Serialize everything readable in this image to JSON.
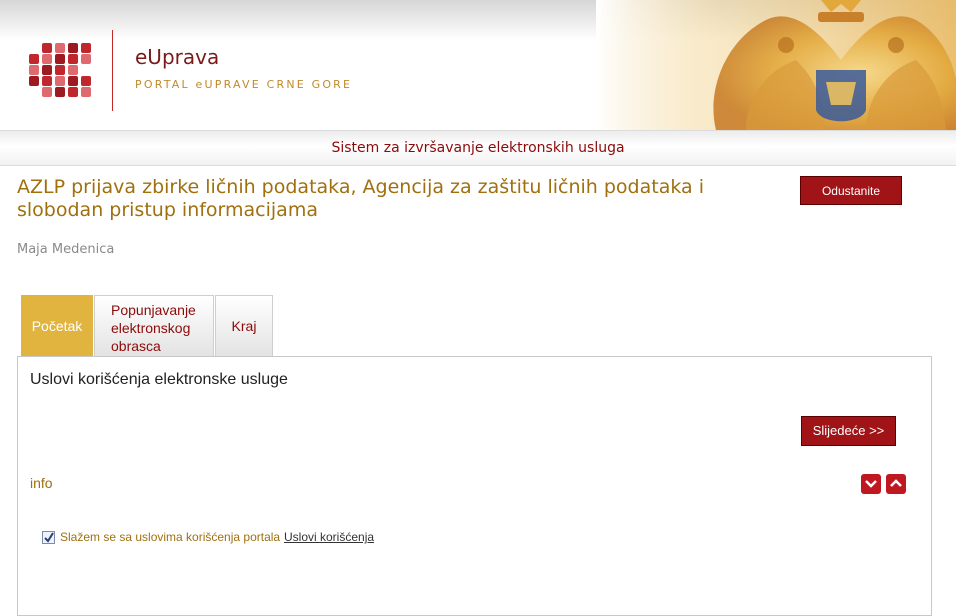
{
  "header": {
    "brand_title": "eUprava",
    "brand_subtitle": "PORTAL eUPRAVE CRNE GORE",
    "logo_icon": "eUprava-logo-icon",
    "emblem_icon": "montenegro-coat-of-arms-icon"
  },
  "service_bar": {
    "text": "Sistem za izvršavanje elektronskih usluga"
  },
  "main": {
    "title": "AZLP prijava zbirke ličnih podataka, Agencija za zaštitu ličnih podataka i slobodan pristup informacijama",
    "cancel_label": "Odustanite",
    "user_name": "Maja Medenica",
    "tabs": [
      {
        "label": "Početak",
        "active": true
      },
      {
        "label_line1": "Popunjavanje",
        "label_line2": "elektronskog",
        "label_line3": "obrasca",
        "active": false
      },
      {
        "label": "Kraj",
        "active": false
      }
    ],
    "panel": {
      "title": "Uslovi korišćenja elektronske usluge",
      "next_label": "Slijedeće >>",
      "info_label": "info",
      "agree_text": "Slažem se sa uslovima korišćenja portala",
      "agree_checked": true,
      "terms_link": "Uslovi korišćenja"
    }
  },
  "colors": {
    "accent_red": "#a01418",
    "gold": "#a0700f",
    "active_tab": "#e0b43e",
    "service_text": "#8b0a0a"
  }
}
